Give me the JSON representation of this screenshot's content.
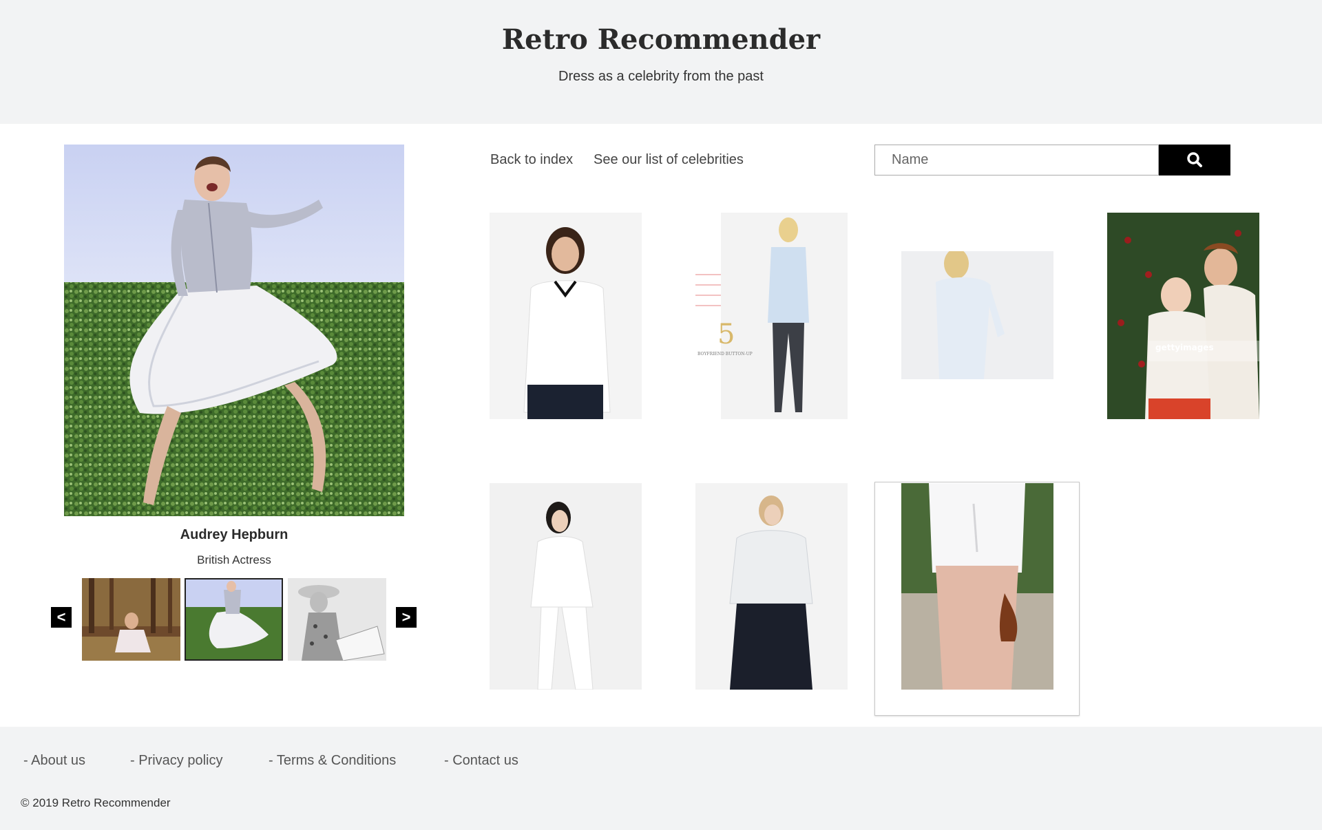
{
  "header": {
    "title": "Retro Recommender",
    "subtitle": "Dress as a celebrity from the past"
  },
  "celebrity": {
    "name": "Audrey Hepburn",
    "description": "British Actress",
    "prev_label": "<",
    "next_label": ">",
    "active_thumbnail": 2,
    "thumbnails_count": 3
  },
  "nav": {
    "back_label": "Back to index",
    "celebrities_label": "See our list of celebrities"
  },
  "search": {
    "placeholder": "Name",
    "icon": "search-icon"
  },
  "products": {
    "count": 7,
    "items": [
      {
        "label": "white blouse, dark hair model"
      },
      {
        "label": "light blue button-up"
      },
      {
        "label": "pale blue shirt"
      },
      {
        "label": "white knit sweater couple"
      },
      {
        "label": "white loose top"
      },
      {
        "label": "sheer organza top"
      },
      {
        "label": "white blouse back view"
      }
    ],
    "watermark_text": "gettyimages",
    "boyfriend_text": "BOYFRIEND BUTTON-UP",
    "boyfriend_number": "5"
  },
  "footer": {
    "links": [
      "- About us",
      "- Privacy policy",
      "- Terms & Conditions",
      "- Contact us"
    ],
    "copyright": "© 2019 Retro Recommender"
  },
  "colors": {
    "header_bg": "#f2f3f4",
    "button_bg": "#000000",
    "text_dark": "#2b2b2b"
  }
}
